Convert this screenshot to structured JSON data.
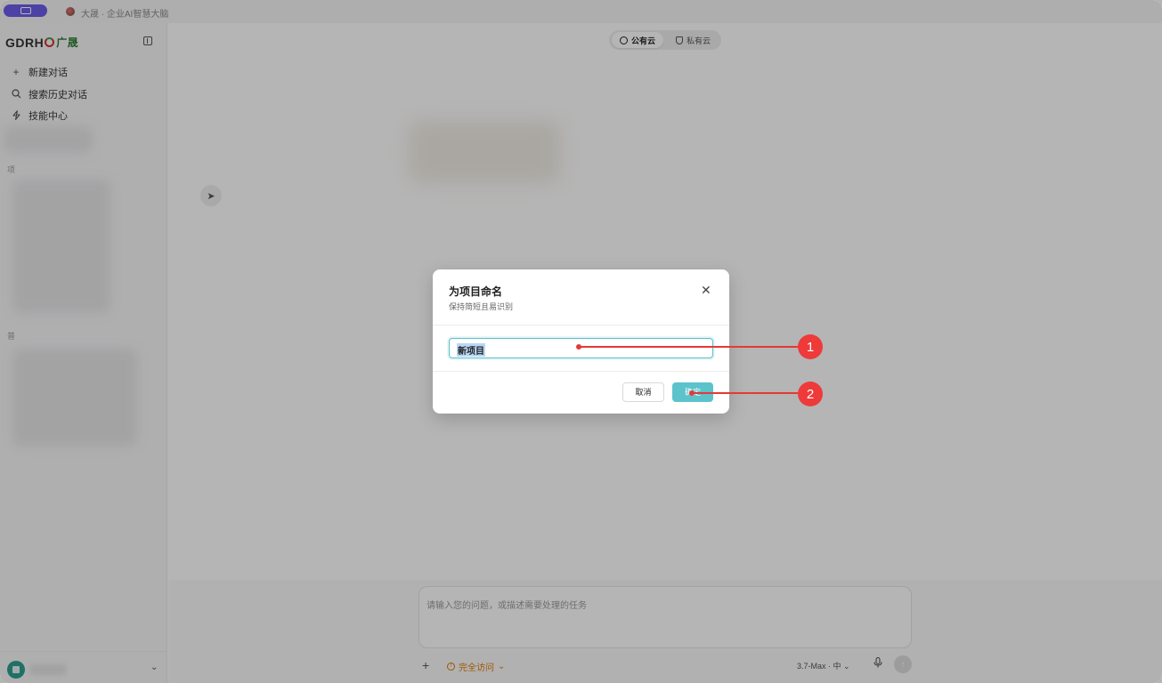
{
  "titlebar": {
    "title": "大晟 · 企业AI智慧大脑"
  },
  "sidebar": {
    "logo_text": "GDRH",
    "logo_cn": "广晟",
    "items": [
      {
        "label": "新建对话",
        "icon": "plus-icon"
      },
      {
        "label": "搜索历史对话",
        "icon": "search-icon"
      },
      {
        "label": "技能中心",
        "icon": "bolt-icon"
      }
    ],
    "section_a": "项",
    "section_b": "普"
  },
  "header": {
    "cloud_options": [
      {
        "label": "公有云",
        "active": true
      },
      {
        "label": "私有云",
        "active": false
      }
    ]
  },
  "composer": {
    "placeholder": "请输入您的问题，或描述需要处理的任务",
    "access_label": "完全访问",
    "model_label": "3.7-Max · 中"
  },
  "dialog": {
    "title": "为项目命名",
    "subtitle": "保持简短且易识别",
    "input_value": "新项目",
    "cancel_label": "取消",
    "ok_label": "确定"
  },
  "callouts": [
    {
      "label": "1"
    },
    {
      "label": "2"
    }
  ],
  "colors": {
    "accent": "#5cc2cb",
    "callout": "#ef3a3a",
    "title_pill": "#6c5ce7",
    "warning": "#e07b00"
  }
}
